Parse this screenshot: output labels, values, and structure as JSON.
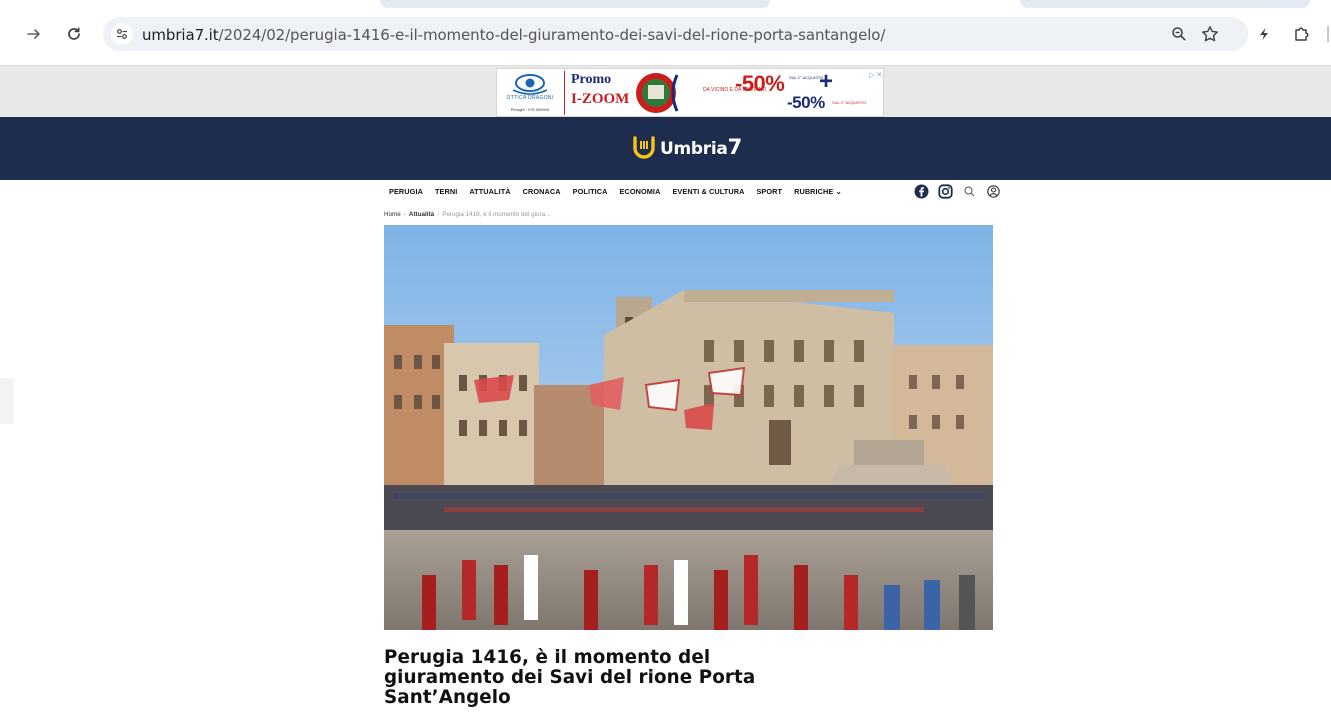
{
  "browser": {
    "back_icon": "arrow-right-icon",
    "reload_icon": "reload-icon",
    "url_host": "umbria7.it",
    "url_path": "/2024/02/perugia-1416-e-il-momento-del-giuramento-dei-savi-del-rione-porta-santangelo/",
    "zoom_icon": "zoom-icon",
    "bookmark_icon": "star-icon",
    "extension_icons": [
      "bolt-icon",
      "puzzle-icon"
    ]
  },
  "ad": {
    "brand": "OTTICA DRAGONI",
    "phone": "Perugia · 075 000000",
    "promo": "Promo",
    "izoom": "I-ZOOM",
    "tagline": "DA VICINO E DA LONTANO",
    "discount_1": "-50%",
    "discount_1_note": "SUL 1° ACQUISTO",
    "plus": "+",
    "discount_2": "-50%",
    "discount_2_note": "SUL 2° ACQUISTO",
    "adchoices": "▷ ✕"
  },
  "site": {
    "logo_text": "Umbria",
    "logo_number": "7",
    "nav": [
      "PERUGIA",
      "TERNI",
      "ATTUALITÀ",
      "CRONACA",
      "POLITICA",
      "ECONOMIA",
      "EVENTI & CULTURA",
      "SPORT",
      "RUBRICHE ⌄"
    ],
    "social_icons": [
      "facebook-icon",
      "instagram-icon",
      "search-icon",
      "user-icon"
    ]
  },
  "breadcrumb": {
    "home": "Home",
    "section": "Attualità",
    "current": "Perugia 1416, è il momento del giura..."
  },
  "article": {
    "title": "Perugia 1416, è il momento del giuramento dei Savi del rione Porta Sant’Angelo",
    "image_alt": "Perugia 1416 - Piazza IV Novembre con Palazzo dei Priori, sbandieratori e corteo storico"
  },
  "colors": {
    "header_bg": "#1e2d4d",
    "logo_yellow": "#f5c518",
    "ad_red": "#cc1d1d",
    "ad_blue": "#1b2a74"
  }
}
